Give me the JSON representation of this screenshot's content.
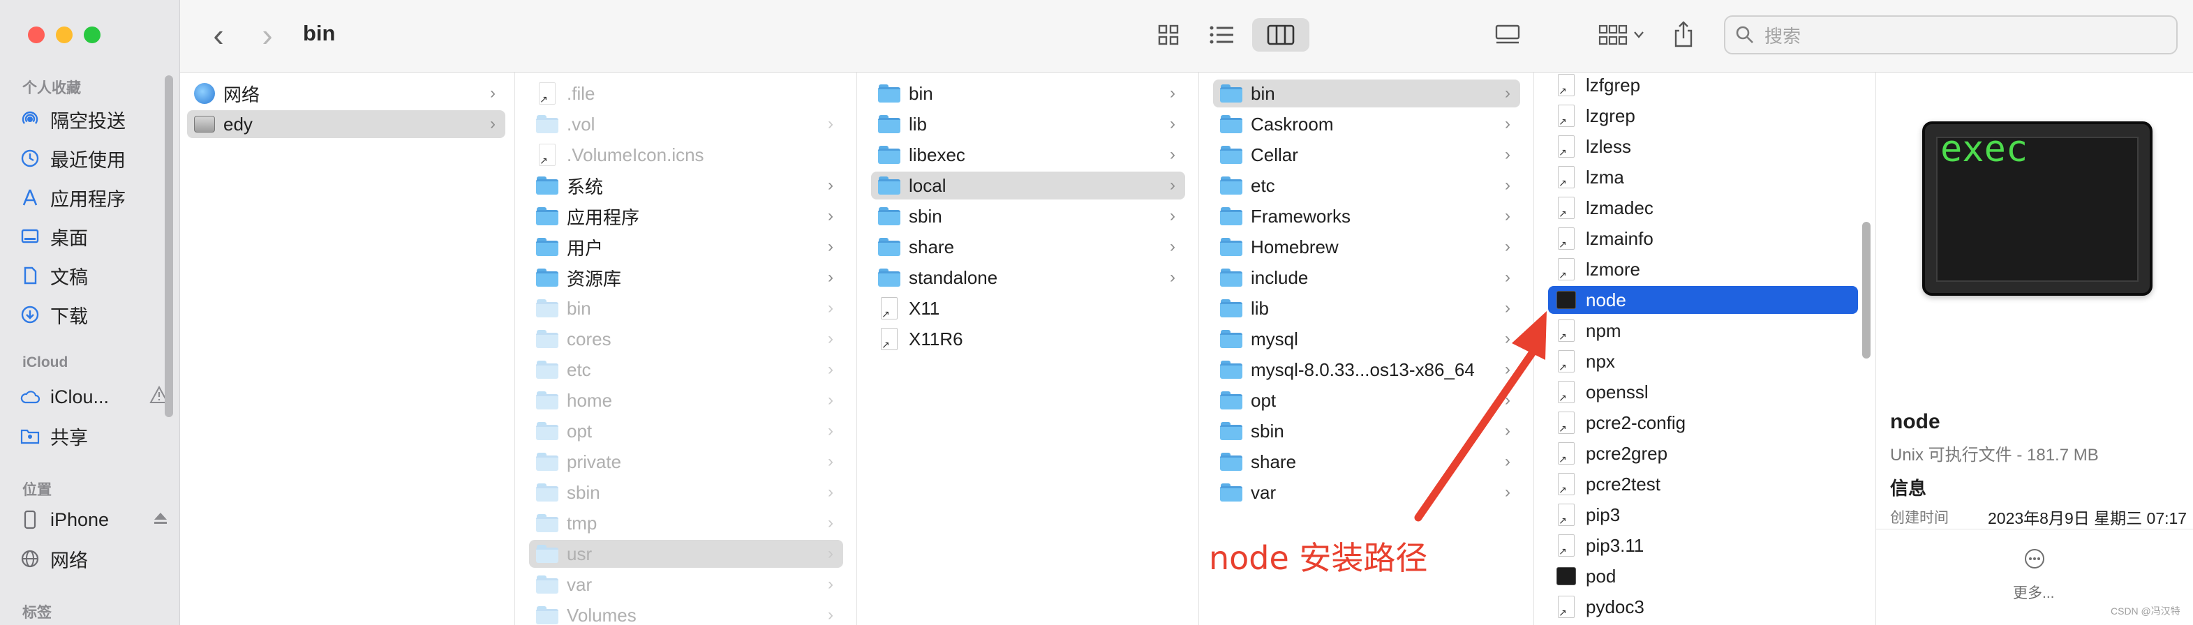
{
  "toolbar": {
    "back": "‹",
    "forward": "›",
    "title": "bin",
    "search_placeholder": "搜索"
  },
  "sidebar": {
    "favorites_heading": "个人收藏",
    "favorites": [
      {
        "label": "隔空投送",
        "icon": "airdrop-icon"
      },
      {
        "label": "最近使用",
        "icon": "clock-icon"
      },
      {
        "label": "应用程序",
        "icon": "apps-icon"
      },
      {
        "label": "桌面",
        "icon": "desktop-icon"
      },
      {
        "label": "文稿",
        "icon": "document-icon"
      },
      {
        "label": "下载",
        "icon": "download-icon"
      }
    ],
    "icloud_heading": "iCloud",
    "icloud": [
      {
        "label": "iClou...",
        "icon": "cloud-icon"
      },
      {
        "label": "共享",
        "icon": "shared-folder-icon"
      }
    ],
    "locations_heading": "位置",
    "locations": [
      {
        "label": "iPhone",
        "icon": "iphone-icon"
      },
      {
        "label": "网络",
        "icon": "network-icon"
      }
    ],
    "tags_heading": "标签"
  },
  "columns": {
    "col1": [
      {
        "name": "网络",
        "icon": "globe",
        "chevron": true
      },
      {
        "name": "edy",
        "icon": "disk",
        "chevron": true,
        "selected": "gray"
      }
    ],
    "col2": [
      {
        "name": ".file",
        "icon": "file",
        "dim": true
      },
      {
        "name": ".vol",
        "icon": "folder",
        "dim": true,
        "chevron": true
      },
      {
        "name": ".VolumeIcon.icns",
        "icon": "file",
        "dim": true
      },
      {
        "name": "系统",
        "icon": "folder",
        "chevron": true
      },
      {
        "name": "应用程序",
        "icon": "folder",
        "chevron": true
      },
      {
        "name": "用户",
        "icon": "folder",
        "chevron": true
      },
      {
        "name": "资源库",
        "icon": "folder",
        "chevron": true
      },
      {
        "name": "bin",
        "icon": "folder",
        "dim": true,
        "chevron": true
      },
      {
        "name": "cores",
        "icon": "folder",
        "dim": true,
        "chevron": true
      },
      {
        "name": "etc",
        "icon": "folder",
        "dim": true,
        "chevron": true
      },
      {
        "name": "home",
        "icon": "folder",
        "dim": true,
        "chevron": true
      },
      {
        "name": "opt",
        "icon": "folder",
        "dim": true,
        "chevron": true
      },
      {
        "name": "private",
        "icon": "folder",
        "dim": true,
        "chevron": true
      },
      {
        "name": "sbin",
        "icon": "folder",
        "dim": true,
        "chevron": true
      },
      {
        "name": "tmp",
        "icon": "folder",
        "dim": true,
        "chevron": true
      },
      {
        "name": "usr",
        "icon": "folder",
        "dim": true,
        "chevron": true,
        "selected": "gray"
      },
      {
        "name": "var",
        "icon": "folder",
        "dim": true,
        "chevron": true
      },
      {
        "name": "Volumes",
        "icon": "folder",
        "dim": true,
        "chevron": true
      }
    ],
    "col3": [
      {
        "name": "bin",
        "icon": "folder",
        "chevron": true
      },
      {
        "name": "lib",
        "icon": "folder",
        "chevron": true
      },
      {
        "name": "libexec",
        "icon": "folder",
        "chevron": true
      },
      {
        "name": "local",
        "icon": "folder",
        "chevron": true,
        "selected": "gray"
      },
      {
        "name": "sbin",
        "icon": "folder",
        "chevron": true
      },
      {
        "name": "share",
        "icon": "folder",
        "chevron": true
      },
      {
        "name": "standalone",
        "icon": "folder",
        "chevron": true
      },
      {
        "name": "X11",
        "icon": "file"
      },
      {
        "name": "X11R6",
        "icon": "file"
      }
    ],
    "col4": [
      {
        "name": "bin",
        "icon": "folder",
        "chevron": true,
        "selected": "gray"
      },
      {
        "name": "Caskroom",
        "icon": "folder",
        "chevron": true
      },
      {
        "name": "Cellar",
        "icon": "folder",
        "chevron": true
      },
      {
        "name": "etc",
        "icon": "folder",
        "chevron": true
      },
      {
        "name": "Frameworks",
        "icon": "folder",
        "chevron": true
      },
      {
        "name": "Homebrew",
        "icon": "folder",
        "chevron": true
      },
      {
        "name": "include",
        "icon": "folder",
        "chevron": true
      },
      {
        "name": "lib",
        "icon": "folder",
        "chevron": true
      },
      {
        "name": "mysql",
        "icon": "folder",
        "chevron": true
      },
      {
        "name": "mysql-8.0.33...os13-x86_64",
        "icon": "folder",
        "chevron": true
      },
      {
        "name": "opt",
        "icon": "folder",
        "chevron": true
      },
      {
        "name": "sbin",
        "icon": "folder",
        "chevron": true
      },
      {
        "name": "share",
        "icon": "folder",
        "chevron": true
      },
      {
        "name": "var",
        "icon": "folder",
        "chevron": true
      }
    ],
    "col5": [
      {
        "name": "lzfgrep",
        "icon": "file"
      },
      {
        "name": "lzgrep",
        "icon": "file"
      },
      {
        "name": "lzless",
        "icon": "file"
      },
      {
        "name": "lzma",
        "icon": "file"
      },
      {
        "name": "lzmadec",
        "icon": "file"
      },
      {
        "name": "lzmainfo",
        "icon": "file"
      },
      {
        "name": "lzmore",
        "icon": "file"
      },
      {
        "name": "node",
        "icon": "exec",
        "selected": "blue"
      },
      {
        "name": "npm",
        "icon": "file"
      },
      {
        "name": "npx",
        "icon": "file"
      },
      {
        "name": "openssl",
        "icon": "file"
      },
      {
        "name": "pcre2-config",
        "icon": "file"
      },
      {
        "name": "pcre2grep",
        "icon": "file"
      },
      {
        "name": "pcre2test",
        "icon": "file"
      },
      {
        "name": "pip3",
        "icon": "file"
      },
      {
        "name": "pip3.11",
        "icon": "file"
      },
      {
        "name": "pod",
        "icon": "exec"
      },
      {
        "name": "pydoc3",
        "icon": "file"
      }
    ]
  },
  "preview": {
    "icon_text": "exec",
    "name": "node",
    "kind": "Unix 可执行文件 - 181.7 MB",
    "info_heading": "信息",
    "created_label": "创建时间",
    "created_value": "2023年8月9日 星期三 07:17",
    "more_label": "更多..."
  },
  "annotation": {
    "text": "node 安装路径",
    "color": "#e8402e"
  },
  "watermark": "CSDN @冯汉特",
  "colors": {
    "selection_blue": "#1f62e0",
    "selection_gray": "#dcdcdc",
    "folder_blue": "#6ec0f3"
  }
}
